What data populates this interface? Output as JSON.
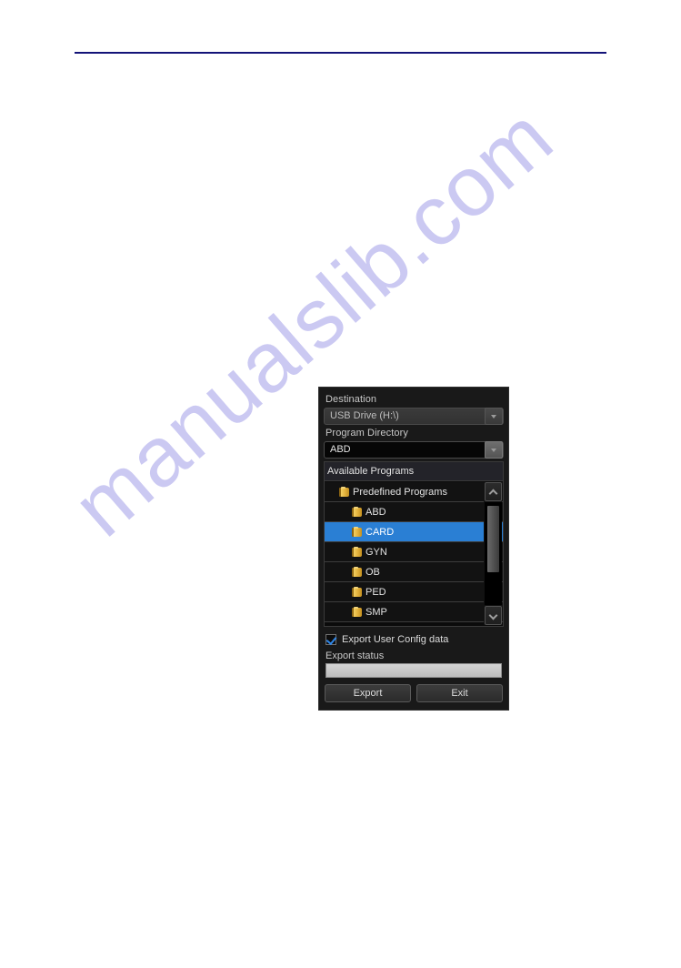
{
  "page": {
    "rule_color": "#131378",
    "watermark": "manualslib.com",
    "watermark_color": "#c9c7f2"
  },
  "dialog": {
    "accent_color": "#2a7fd4",
    "destination": {
      "label": "Destination",
      "value": "USB Drive (H:\\)",
      "enabled": false
    },
    "program_directory": {
      "label": "Program Directory",
      "value": "ABD",
      "enabled": true
    },
    "list": {
      "header": "Available Programs",
      "rows": [
        {
          "label": "Predefined Programs",
          "level": 0,
          "selected": false
        },
        {
          "label": "ABD",
          "level": 1,
          "selected": false
        },
        {
          "label": "CARD",
          "level": 1,
          "selected": true
        },
        {
          "label": "GYN",
          "level": 1,
          "selected": false
        },
        {
          "label": "OB",
          "level": 1,
          "selected": false
        },
        {
          "label": "PED",
          "level": 1,
          "selected": false
        },
        {
          "label": "SMP",
          "level": 1,
          "selected": false
        }
      ]
    },
    "export_user_config": {
      "label": "Export User Config data",
      "checked": true
    },
    "export_status": {
      "label": "Export status",
      "percent": 0
    },
    "buttons": {
      "export": "Export",
      "exit": "Exit"
    }
  }
}
